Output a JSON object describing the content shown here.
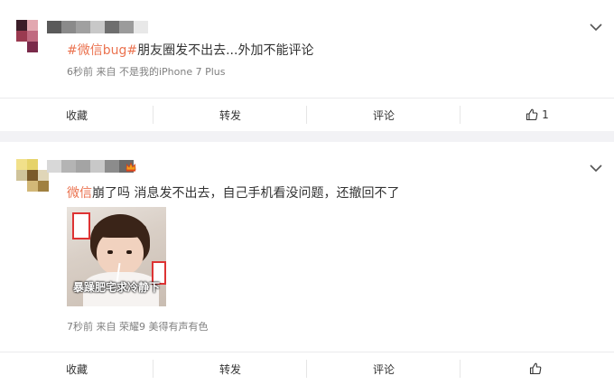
{
  "posts": [
    {
      "content": {
        "hashtag": "#微信bug#",
        "text": "朋友圈发不出去...外加不能评论"
      },
      "meta": "6秒前 来自 不是我的iPhone 7 Plus",
      "actions": {
        "collect": "收藏",
        "repost": "转发",
        "comment": "评论",
        "like_count": "1"
      },
      "avatar_colors": [
        "#3b1d28",
        "#e2a8b0",
        "#ffffff",
        "#9a3a50",
        "#c06a80",
        "#ffffff",
        "#ffffff",
        "#7a2a4a",
        "#ffffff"
      ],
      "name_colors": [
        "#5a5a5a",
        "#8a8a8a",
        "#a0a0a0",
        "#c8c8c8",
        "#6e6e6e",
        "#9b9b9b",
        "#e8e8e8",
        "#ffffff"
      ]
    },
    {
      "content": {
        "mention": "微信",
        "text": "崩了吗 消息发不出去，自己手机看没问题，还撤回不了"
      },
      "image_caption": "暴躁肥宅求冷静下",
      "meta": "7秒前 来自 荣耀9 美得有声有色",
      "actions": {
        "collect": "收藏",
        "repost": "转发",
        "comment": "评论",
        "like_count": ""
      },
      "avatar_colors": [
        "#f1e08a",
        "#e6d36a",
        "#ffffff",
        "#cfc39a",
        "#7a5a2a",
        "#e0d6b8",
        "#d2b878",
        "#a08040",
        "#ffffff"
      ],
      "name_colors": [
        "#d8d8d8",
        "#b4b4b4",
        "#a4a4a4",
        "#c8c8c8",
        "#8c8c8c",
        "#6a6a6a"
      ]
    }
  ],
  "colors": {
    "accent": "#eb7350",
    "meta": "#808080",
    "background": "#f2f2f5"
  }
}
